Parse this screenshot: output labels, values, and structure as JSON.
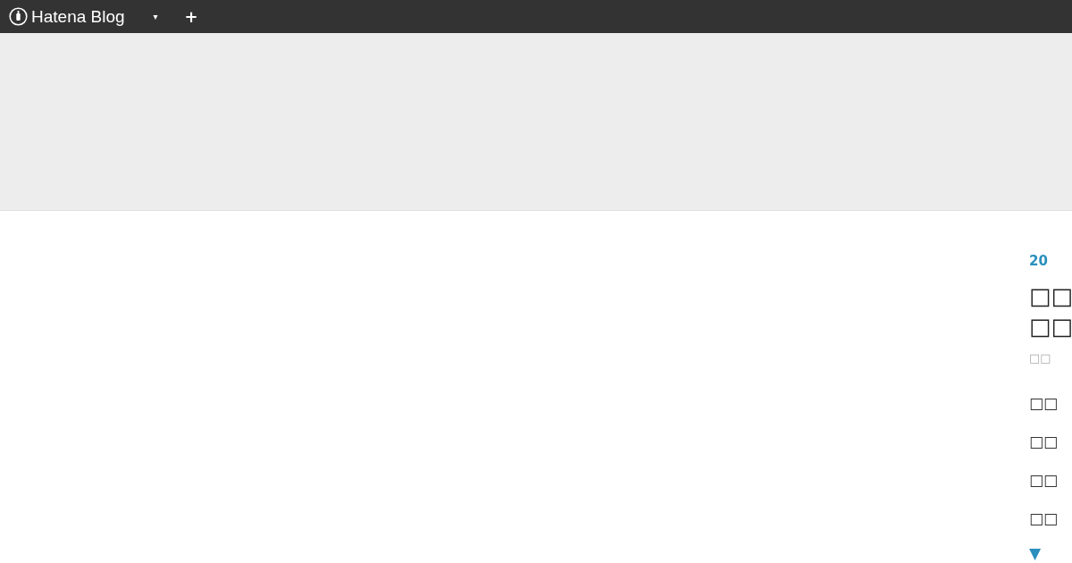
{
  "header": {
    "logo": "Hatena Blog",
    "menu_caret": "▾",
    "add_button": "+"
  },
  "entry": {
    "date": "20",
    "title_lines": [
      "□□",
      "□□"
    ],
    "meta": "□□",
    "paragraphs": [
      "□□",
      "□□",
      "□□",
      "□□"
    ],
    "more_link": "▼"
  }
}
